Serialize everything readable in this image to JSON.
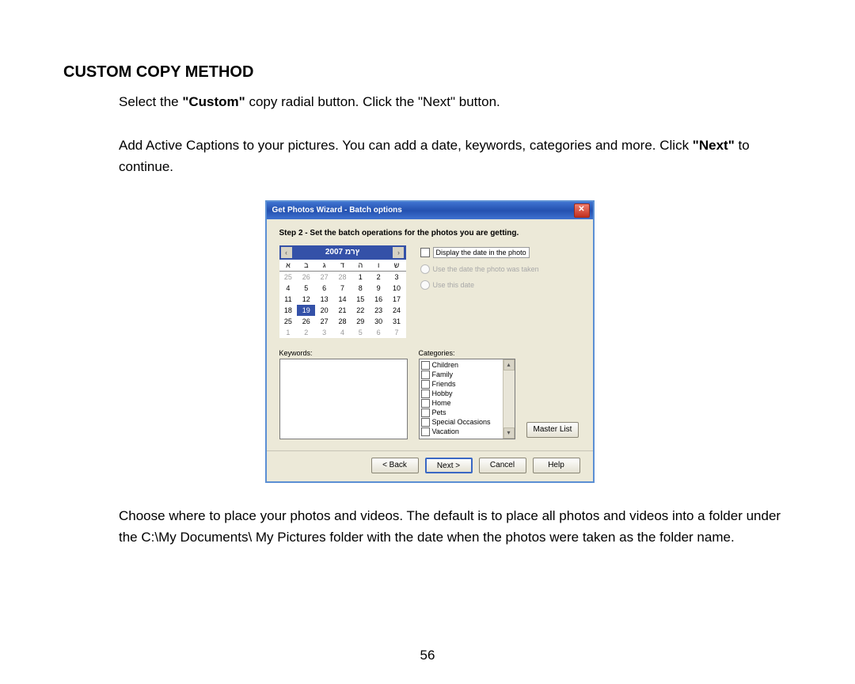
{
  "heading": "CUSTOM COPY METHOD",
  "para1_a": "Select the ",
  "para1_b": "\"Custom\"",
  "para1_c": " copy radial button. Click the \"Next\" button.",
  "para2_a": "Add Active Captions to your pictures. You can add a date, keywords, categories and more. Click ",
  "para2_b": "\"Next\"",
  "para2_c": " to continue.",
  "para3": "Choose where to place your photos and videos. The default is to place all photos and videos into a folder under the C:\\My Documents\\ My Pictures folder with the date when the photos were taken as the folder name.",
  "page_number": "56",
  "wizard": {
    "title": "Get Photos Wizard - Batch options",
    "step": "Step 2 - Set the batch operations for the photos you are getting.",
    "calendar": {
      "month_label": "2007 ץרמ",
      "dows": [
        "א",
        "ב",
        "ג",
        "ד",
        "ה",
        "ו",
        "ש"
      ],
      "weeks": [
        [
          "25",
          "26",
          "27",
          "28",
          "1",
          "2",
          "3"
        ],
        [
          "4",
          "5",
          "6",
          "7",
          "8",
          "9",
          "10"
        ],
        [
          "11",
          "12",
          "13",
          "14",
          "15",
          "16",
          "17"
        ],
        [
          "18",
          "19",
          "20",
          "21",
          "22",
          "23",
          "24"
        ],
        [
          "25",
          "26",
          "27",
          "28",
          "29",
          "30",
          "31"
        ],
        [
          "1",
          "2",
          "3",
          "4",
          "5",
          "6",
          "7"
        ]
      ],
      "selected": "19"
    },
    "display_date_label": "Display the date in the photo",
    "radio_photo_date": "Use the date the photo was taken",
    "radio_this_date": "Use this date",
    "keywords_label": "Keywords:",
    "categories_label": "Categories:",
    "categories": [
      "Children",
      "Family",
      "Friends",
      "Hobby",
      "Home",
      "Pets",
      "Special Occasions",
      "Vacation"
    ],
    "master_list": "Master List",
    "buttons": {
      "back": "< Back",
      "next": "Next >",
      "cancel": "Cancel",
      "help": "Help"
    }
  }
}
